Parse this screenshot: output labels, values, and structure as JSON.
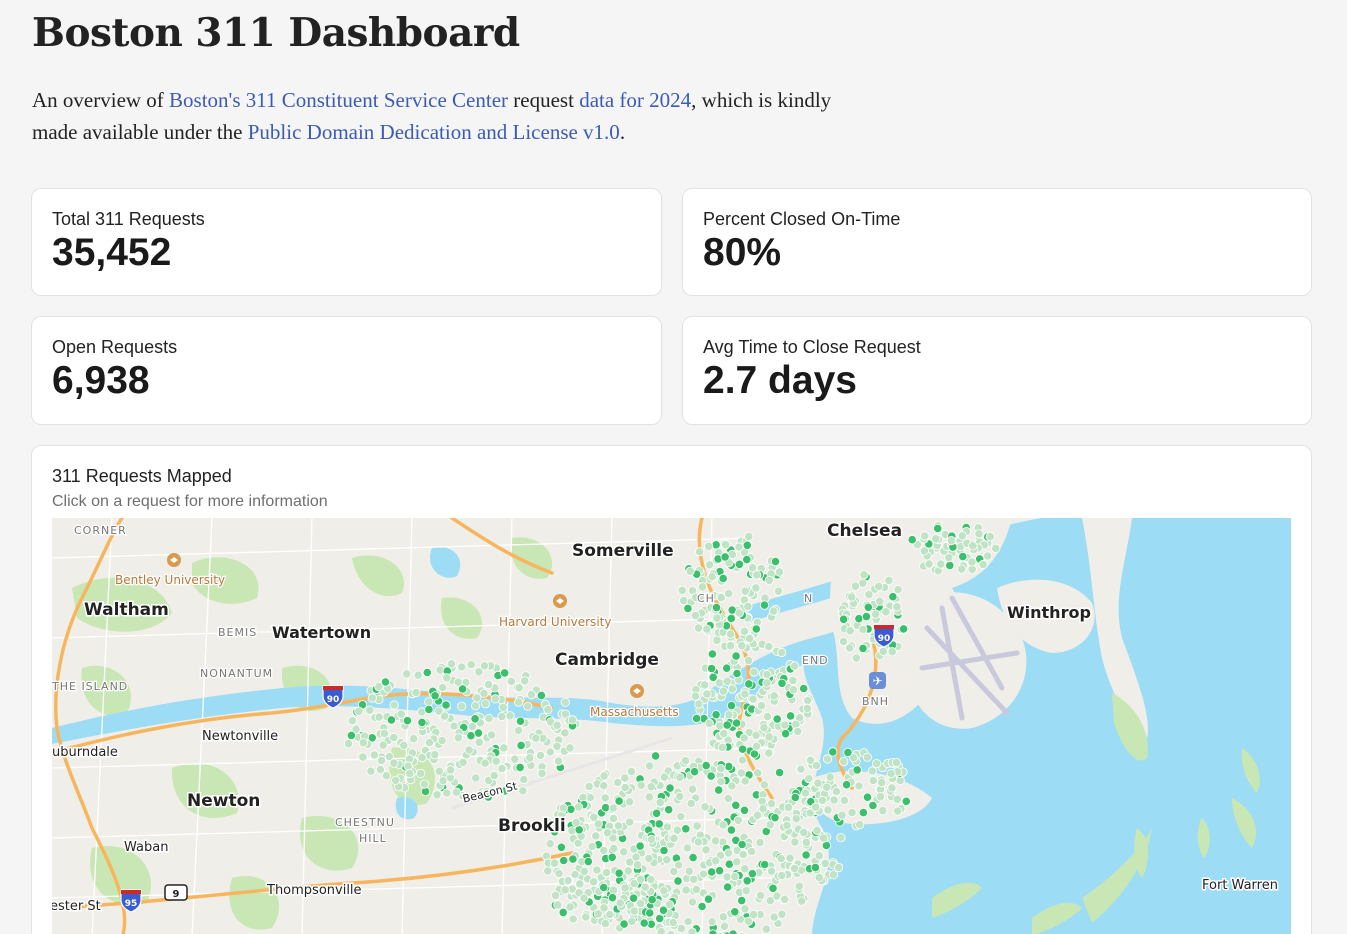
{
  "header": {
    "title": "Boston 311 Dashboard",
    "intro": {
      "t1": "An overview of ",
      "link1": "Boston's 311 Constituent Service Center",
      "t2": " request ",
      "link2": "data for 2024",
      "t3": ", which is kindly made available under the ",
      "link3": "Public Domain Dedication and License v1.0",
      "t4": "."
    }
  },
  "kpis": {
    "total": {
      "label": "Total 311 Requests",
      "value": "35,452"
    },
    "percent": {
      "label": "Percent Closed On-Time",
      "value": "80%"
    },
    "open": {
      "label": "Open Requests",
      "value": "6,938"
    },
    "avg": {
      "label": "Avg Time to Close Request",
      "value": "2.7 days"
    }
  },
  "map": {
    "title": "311 Requests Mapped",
    "subtitle": "Click on a request for more information",
    "labels": {
      "chelsea": "Chelsea",
      "somerville": "Somerville",
      "winthrop": "Winthrop",
      "waltham": "Waltham",
      "watertown": "Watertown",
      "cambridge": "Cambridge",
      "newtonville": "Newtonville",
      "newton": "Newton",
      "brookline": "Brookli",
      "waban": "Waban",
      "thompsonville": "Thompsonville",
      "fort_warren": "Fort Warren",
      "bentley": "Bentley University",
      "harvard": "Harvard University",
      "massachusetts": "Massachusetts",
      "corner": "CORNER",
      "bemis": "BEMIS",
      "nonantum": "NONANTUM",
      "the_island": "THE ISLAND",
      "auburndale": "uburndale",
      "chestnut": "CHESTNU",
      "hill": "HILL",
      "beacon_st": "Beacon St",
      "chester_st": "ester St",
      "charlestown": "CH",
      "north_end": "N",
      "east_end": "END",
      "bnh": "BNH",
      "i90_a": "90",
      "i90_b": "90",
      "i95": "95",
      "route9": "9"
    },
    "colors": {
      "water": "#9ddcf5",
      "land": "#f0eee8",
      "park": "#c9e7b4",
      "highway": "#f7b55e",
      "marker_open": "#3bbf6c",
      "marker_closed": "#bfe3c4"
    }
  }
}
